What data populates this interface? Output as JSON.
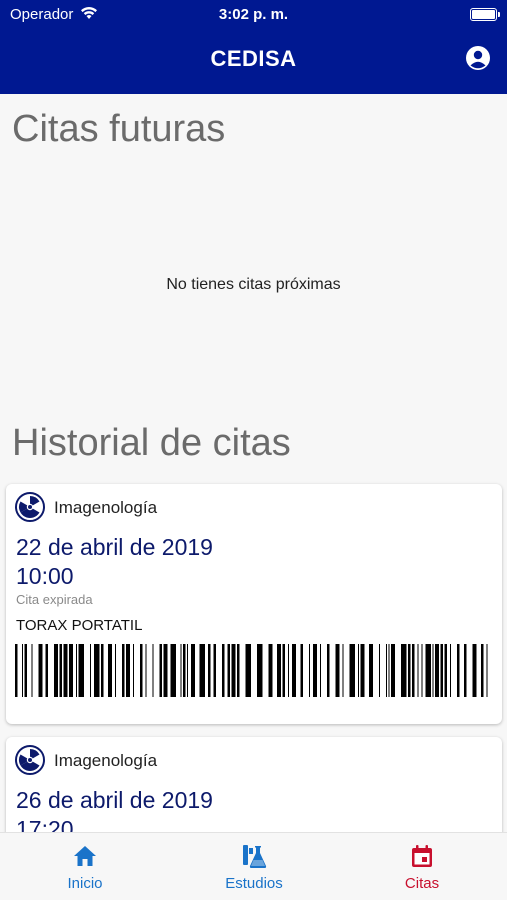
{
  "status_bar": {
    "carrier": "Operador",
    "time": "3:02 p. m."
  },
  "app_bar": {
    "title": "CEDISA",
    "profile_icon": "account-circle-icon"
  },
  "future": {
    "title": "Citas futuras",
    "empty_message": "No tienes citas próximas"
  },
  "history": {
    "title": "Historial de citas",
    "appointments": [
      {
        "department": "Imagenología",
        "date": "22 de abril de 2019",
        "time": "10:00",
        "status": "Cita expirada",
        "exam": "TORAX PORTATIL",
        "icon": "radiation-icon"
      },
      {
        "department": "Imagenología",
        "date": "26 de abril de 2019",
        "time": "17:20",
        "icon": "radiation-icon"
      }
    ]
  },
  "tabs": [
    {
      "label": "Inicio",
      "icon": "home-icon",
      "active": false
    },
    {
      "label": "Estudios",
      "icon": "flask-icon",
      "active": false
    },
    {
      "label": "Citas",
      "icon": "calendar-icon",
      "active": true
    }
  ],
  "colors": {
    "app_bar": "#001891",
    "tab_blue": "#1a73c9",
    "tab_active": "#c8102e",
    "date_text": "#0d1a6b"
  }
}
